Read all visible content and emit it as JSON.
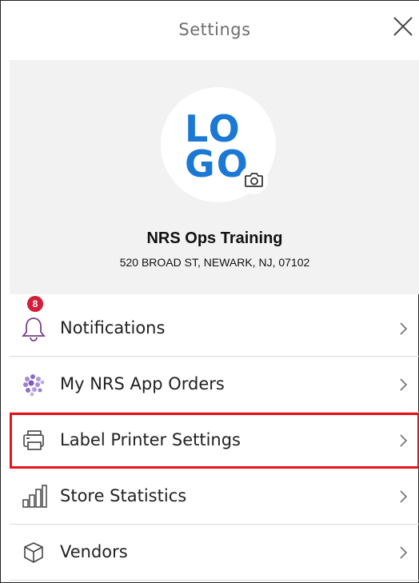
{
  "header": {
    "title": "Settings"
  },
  "profile": {
    "logo_text_line1": "LO",
    "logo_text_line2": "GO",
    "store_name": "NRS Ops Training",
    "store_address": "520 BROAD ST,  NEWARK,  NJ, 07102"
  },
  "menu": {
    "items": [
      {
        "label": "Notifications",
        "icon": "bell-icon",
        "badge": "8"
      },
      {
        "label": "My NRS App Orders",
        "icon": "app-orders-icon"
      },
      {
        "label": "Label Printer Settings",
        "icon": "printer-icon",
        "highlighted": true
      },
      {
        "label": "Store Statistics",
        "icon": "bar-chart-icon"
      },
      {
        "label": "Vendors",
        "icon": "box-icon"
      }
    ]
  },
  "colors": {
    "accent_blue": "#1b79d4",
    "badge_red": "#d31d3a",
    "highlight_red": "#e8141b",
    "profile_bg": "#f2f2f2"
  }
}
